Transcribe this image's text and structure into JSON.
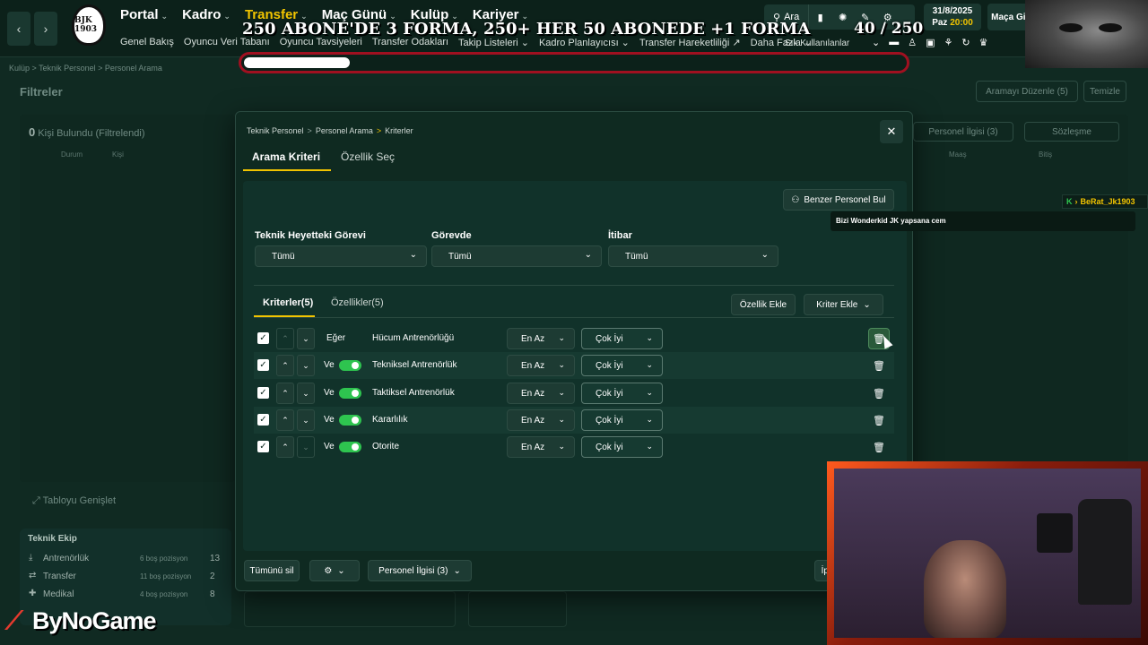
{
  "topbar": {
    "club_logo_text": "BJK 1903",
    "main_nav": [
      {
        "label": "Portal",
        "active": false
      },
      {
        "label": "Kadro",
        "active": false
      },
      {
        "label": "Transfer",
        "active": true
      },
      {
        "label": "Maç Günü",
        "active": false
      },
      {
        "label": "Kulüp",
        "active": false
      },
      {
        "label": "Kariyer",
        "active": false
      }
    ],
    "sub_nav": [
      "Genel Bakış",
      "Oyuncu Veri Tabanı",
      "Oyuncu Tavsiyeleri",
      "Transfer Odakları",
      "Takip Listeleri ⌄",
      "Kadro Planlayıcısı ⌄",
      "Transfer Hareketliliği ↗",
      "Daha Fazla ⌄"
    ],
    "search_label": "Ara",
    "date": "31/8/2025",
    "day": "Paz",
    "time": "20:00",
    "go_button": "Maça Git",
    "favorites_label": "Sık Kullanılanlar"
  },
  "overlay": {
    "title": "250 ABONE'DE 3 FORMA, 250+ HER 50 ABONEDE +1 FORMA",
    "count": "40 / 250",
    "progress_fraction": 0.16,
    "chat_user": "BeRat_Jk1903",
    "chat_message": "Bizi Wonderkid JK yapsana cem",
    "brand": "ByNoGame"
  },
  "background": {
    "breadcrumb": "Kulüp > Teknik Personel > Personel Arama",
    "filters_title": "Filtreler",
    "edit_search": "Aramayı Düzenle (5)",
    "clear": "Temizle",
    "found_count": "0",
    "found_label": "Kişi Bulundu (Filtrelendi)",
    "columns_left": [
      "Durum",
      "Kişi"
    ],
    "right_btn1": "Personel İlgisi (3)",
    "right_btn2": "Sözleşme",
    "columns_right": [
      "Maaş",
      "Bitiş"
    ],
    "expand_table": "Tabloyu Genişlet",
    "staff_title": "Teknik Ekip",
    "staff_rows": [
      {
        "name": "Antrenörlük",
        "open": "6 boş pozisyon",
        "count": "13"
      },
      {
        "name": "Transfer",
        "open": "11 boş pozisyon",
        "count": "2"
      },
      {
        "name": "Medikal",
        "open": "4 boş pozisyon",
        "count": "8"
      }
    ]
  },
  "modal": {
    "breadcrumb": [
      "Teknik Personel",
      "Personel Arama",
      "Kriterler"
    ],
    "tabs": [
      "Arama Kriteri",
      "Özellik Seç"
    ],
    "similar_button": "Benzer Personel Bul",
    "filters": [
      {
        "label": "Teknik Heyetteki Görevi",
        "value": "Tümü"
      },
      {
        "label": "Görevde",
        "value": "Tümü"
      },
      {
        "label": "İtibar",
        "value": "Tümü"
      }
    ],
    "sub_tabs": [
      "Kriterler(5)",
      "Özellikler(5)"
    ],
    "add_property": "Özellik Ekle",
    "add_criterion": "Kriter Ekle",
    "criteria": [
      {
        "connector": "Eğer",
        "name": "Hücum Antrenörlüğü",
        "op": "En Az",
        "value": "Çok İyi"
      },
      {
        "connector": "Ve",
        "name": "Tekniksel Antrenörlük",
        "op": "En Az",
        "value": "Çok İyi"
      },
      {
        "connector": "Ve",
        "name": "Taktiksel Antrenörlük",
        "op": "En Az",
        "value": "Çok İyi"
      },
      {
        "connector": "Ve",
        "name": "Kararlılık",
        "op": "En Az",
        "value": "Çok İyi"
      },
      {
        "connector": "Ve",
        "name": "Otorite",
        "op": "En Az",
        "value": "Çok İyi"
      }
    ],
    "footer": {
      "delete_all": "Tümünü sil",
      "staff_interest": "Personel İlgisi (3)",
      "right_partial": "İp"
    }
  },
  "colors": {
    "accent": "#f2c400",
    "toggle_on": "#2ec44f",
    "background": "#102a22"
  }
}
